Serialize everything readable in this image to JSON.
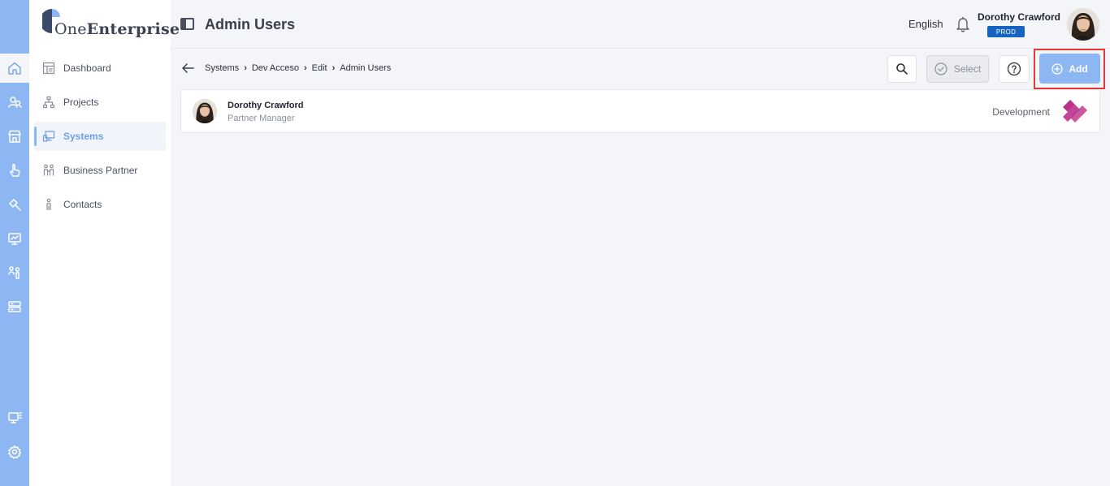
{
  "app": {
    "logo_text_one": "One",
    "logo_text_enterprise": "Enterprise",
    "page_title": "Admin Users"
  },
  "rail": {
    "items": [
      {
        "icon": "home-icon",
        "active": true
      },
      {
        "icon": "users-icon"
      },
      {
        "icon": "store-icon"
      },
      {
        "icon": "hand-pointer-icon"
      },
      {
        "icon": "hammer-icon"
      },
      {
        "icon": "monitor-chart-icon"
      },
      {
        "icon": "people-icon"
      },
      {
        "icon": "server-icon"
      },
      {
        "icon": "display-grid-icon"
      },
      {
        "icon": "gear-icon"
      }
    ]
  },
  "sidebar": {
    "items": [
      {
        "label": "Dashboard",
        "icon": "dashboard-icon"
      },
      {
        "label": "Projects",
        "icon": "hierarchy-icon"
      },
      {
        "label": "Systems",
        "icon": "systems-icon",
        "active": true
      },
      {
        "label": "Business Partner",
        "icon": "partner-icon"
      },
      {
        "label": "Contacts",
        "icon": "person-icon"
      }
    ]
  },
  "header": {
    "language": "English",
    "user_name": "Dorothy Crawford",
    "env_badge": "PROD"
  },
  "breadcrumb": [
    "Systems",
    "Dev Acceso",
    "Edit",
    "Admin Users"
  ],
  "toolbar": {
    "select_label": "Select",
    "add_label": "Add"
  },
  "rows": [
    {
      "name": "Dorothy Crawford",
      "role": "Partner Manager",
      "environment": "Development"
    }
  ],
  "colors": {
    "accent": "#8cb7f2",
    "badge": "#1565c0",
    "highlight": "#e53935"
  }
}
